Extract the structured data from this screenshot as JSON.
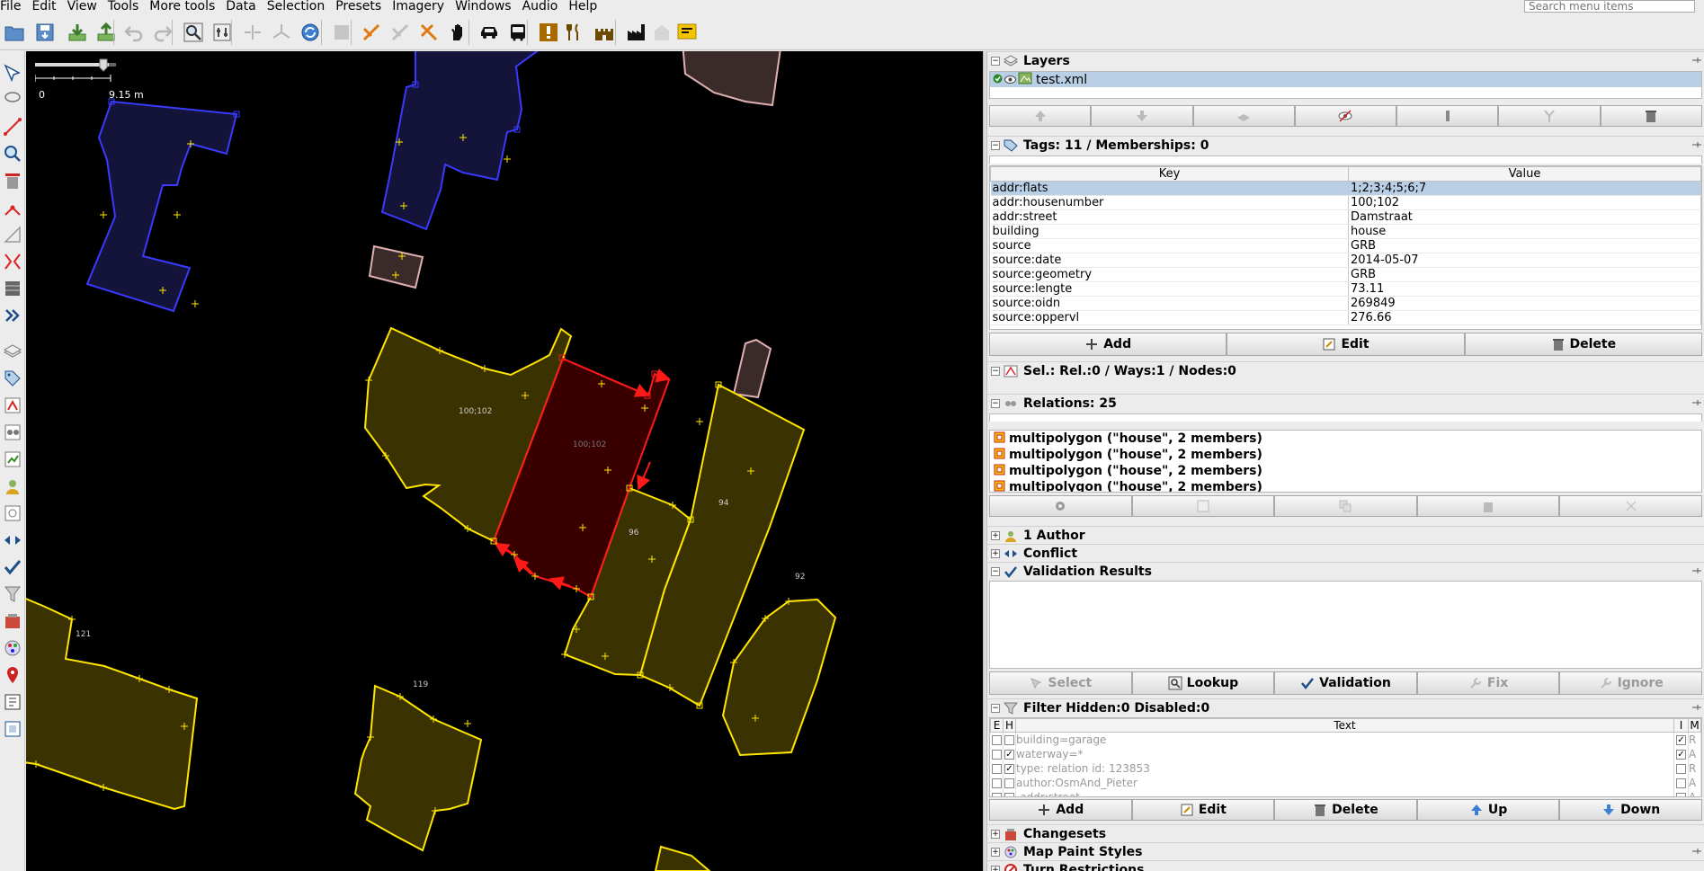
{
  "menu": {
    "items": [
      "File",
      "Edit",
      "View",
      "Tools",
      "More tools",
      "Data",
      "Selection",
      "Presets",
      "Imagery",
      "Windows",
      "Audio",
      "Help"
    ],
    "search_placeholder": "Search menu items"
  },
  "toolbar": {
    "icons": [
      "open-icon",
      "save-icon",
      "download-icon",
      "upload-icon",
      "undo-icon",
      "redo-icon",
      "zoom-to-icon",
      "preferences-icon",
      "split-way-icon",
      "combine-way-icon",
      "update-data-icon",
      "tool-disabled-icon",
      "tool-orange-1-icon",
      "tool-gray-icon",
      "tool-orange-2-icon",
      "hand-icon",
      "car-icon",
      "bus-icon",
      "exclamation-icon",
      "fork-knife-icon",
      "castle-icon",
      "factory-icon",
      "building-icon",
      "speech-icon"
    ]
  },
  "map": {
    "scale_zero": "0",
    "scale_distance": "9.15 m",
    "labels": [
      "100;102",
      "100;102",
      "96",
      "94",
      "92",
      "121",
      "119"
    ],
    "colors": {
      "background": "#000000",
      "building_fill": "#3a3200",
      "building_stroke": "#ffe600",
      "selected_fill": "#3a0000",
      "selected_stroke": "#ff1a1a",
      "blue_fill": "#14143a",
      "blue_stroke": "#3a3aff",
      "pink_fill": "#3a2a2a",
      "pink_stroke": "#e0b0b0"
    }
  },
  "layers": {
    "title": "Layers",
    "items": [
      {
        "name": "test.xml"
      }
    ]
  },
  "tags": {
    "title": "Tags: 11 / Memberships: 0",
    "key_header": "Key",
    "value_header": "Value",
    "rows": [
      {
        "key": "addr:flats",
        "value": "1;2;3;4;5;6;7"
      },
      {
        "key": "addr:housenumber",
        "value": "100;102"
      },
      {
        "key": "addr:street",
        "value": "Damstraat"
      },
      {
        "key": "building",
        "value": "house"
      },
      {
        "key": "source",
        "value": "GRB"
      },
      {
        "key": "source:date",
        "value": "2014-05-07"
      },
      {
        "key": "source:geometry",
        "value": "GRB"
      },
      {
        "key": "source:lengte",
        "value": "73.11"
      },
      {
        "key": "source:oidn",
        "value": "269849"
      },
      {
        "key": "source:oppervl",
        "value": "276.66"
      }
    ],
    "buttons": {
      "add": "Add",
      "edit": "Edit",
      "delete": "Delete"
    }
  },
  "selection": {
    "title": "Sel.: Rel.:0 / Ways:1 / Nodes:0"
  },
  "relations": {
    "title": "Relations: 25",
    "rows": [
      "multipolygon (\"house\", 2 members)",
      "multipolygon (\"house\", 2 members)",
      "multipolygon (\"house\", 2 members)",
      "multipolygon (\"house\", 2 members)"
    ]
  },
  "collapsed_panels": {
    "authors": "1 Author",
    "conflict": "Conflict"
  },
  "validation": {
    "title": "Validation Results",
    "buttons": {
      "select": "Select",
      "lookup": "Lookup",
      "validation": "Validation",
      "fix": "Fix",
      "ignore": "Ignore"
    }
  },
  "filter": {
    "title": "Filter Hidden:0 Disabled:0",
    "headers": {
      "e": "E",
      "h": "H",
      "text": "Text",
      "i": "I",
      "m": "M"
    },
    "rows": [
      {
        "e": false,
        "h": false,
        "text": "building=garage",
        "i": true,
        "m": "R"
      },
      {
        "e": false,
        "h": true,
        "text": "waterway=*",
        "i": true,
        "m": "A"
      },
      {
        "e": false,
        "h": true,
        "text": "type: relation id: 123853",
        "i": false,
        "m": "R"
      },
      {
        "e": false,
        "h": false,
        "text": "author:OsmAnd_Pieter",
        "i": false,
        "m": "A"
      },
      {
        "e": false,
        "h": false,
        "text": "-addr:street",
        "i": false,
        "m": "A"
      }
    ],
    "buttons": {
      "add": "Add",
      "edit": "Edit",
      "delete": "Delete",
      "up": "Up",
      "down": "Down"
    }
  },
  "bottom_panels": {
    "changesets": "Changesets",
    "map_paint_styles": "Map Paint Styles",
    "turn_restrictions": "Turn Restrictions"
  }
}
